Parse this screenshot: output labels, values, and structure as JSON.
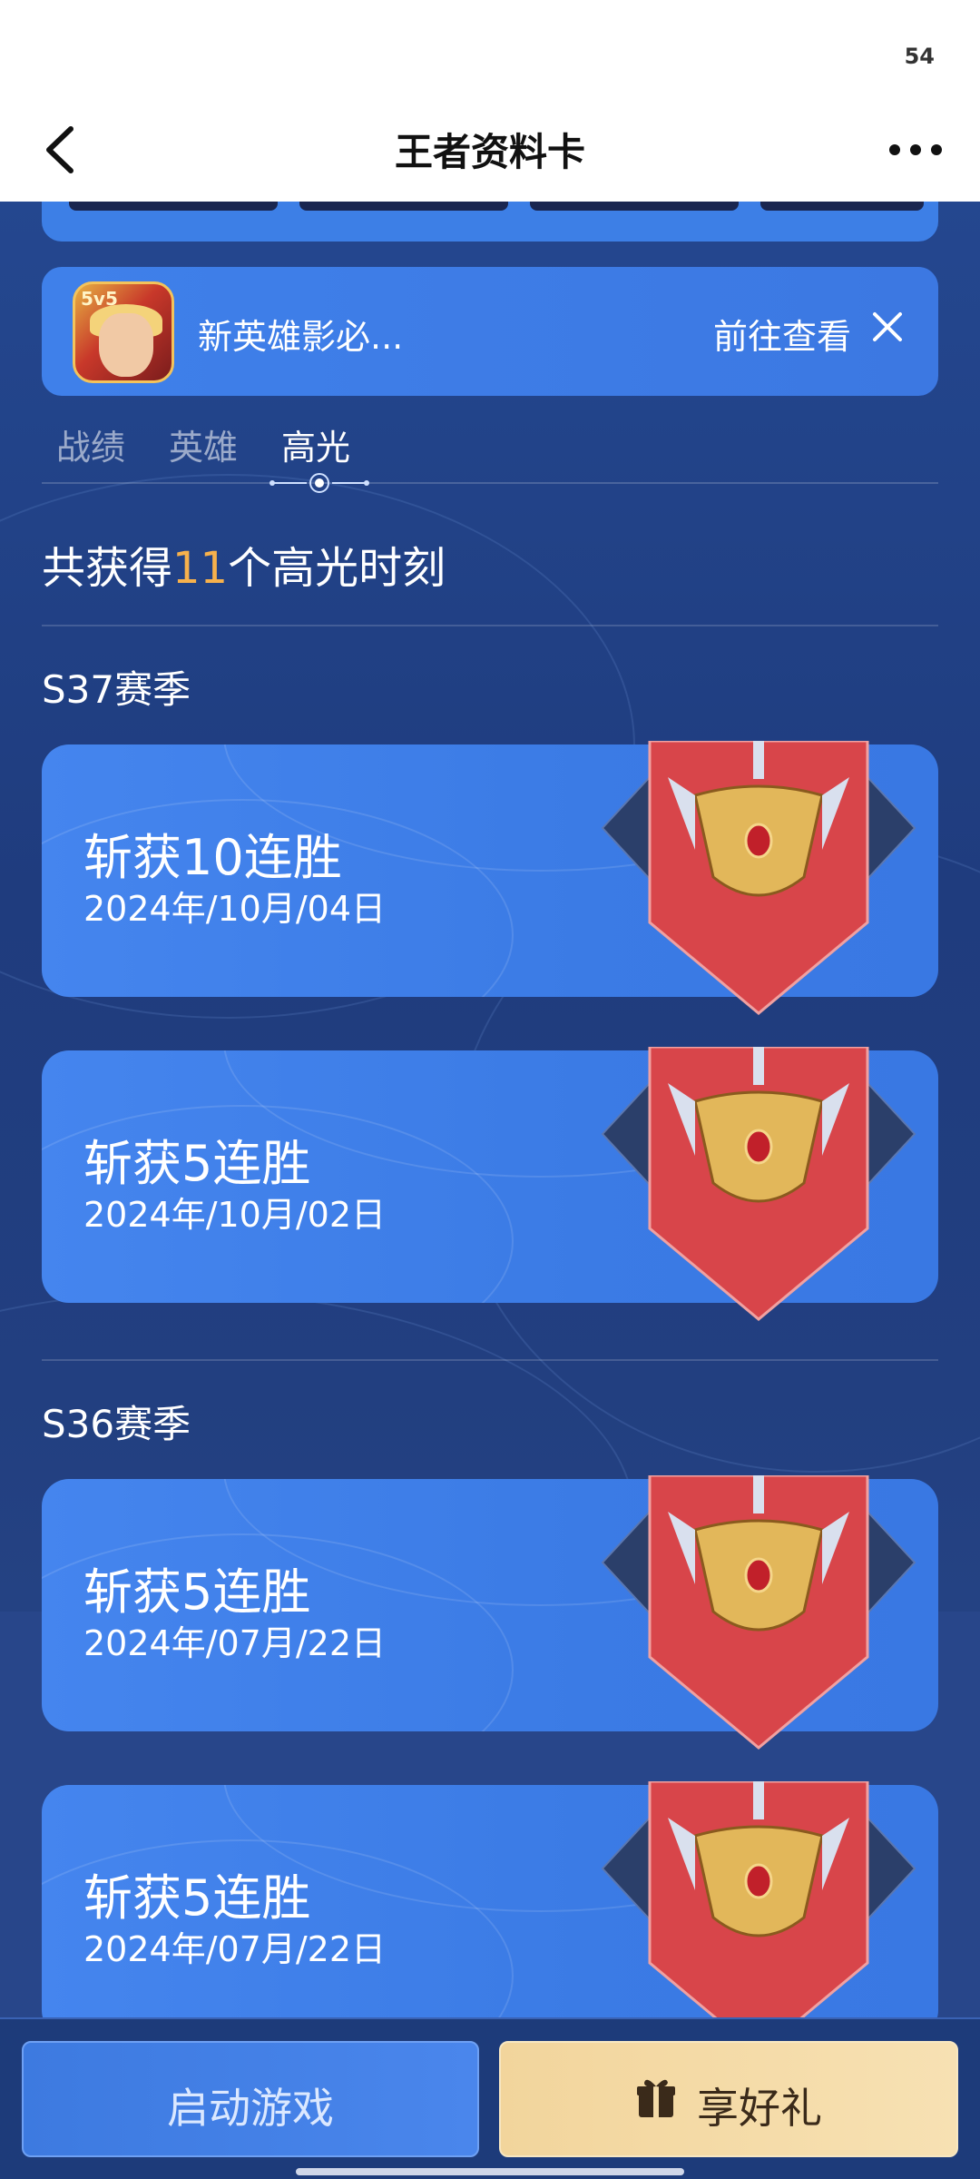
{
  "status_bar": {
    "indicator": "54"
  },
  "header": {
    "title": "王者资料卡",
    "back_icon": "chevron-left-icon",
    "more_icon": "more-icon"
  },
  "banner": {
    "icon_label": "5v5",
    "text": "新英雄影必...",
    "link": "前往查看",
    "close_icon": "close-icon"
  },
  "tabs": [
    {
      "label": "战绩",
      "active": false
    },
    {
      "label": "英雄",
      "active": false
    },
    {
      "label": "高光",
      "active": true
    }
  ],
  "summary": {
    "prefix": "共获得",
    "count": "11",
    "suffix": "个高光时刻"
  },
  "seasons": [
    {
      "label": "S37赛季",
      "items": [
        {
          "title": "斩获10连胜",
          "date": "2024年/10月/04日"
        },
        {
          "title": "斩获5连胜",
          "date": "2024年/10月/02日"
        }
      ]
    },
    {
      "label": "S36赛季",
      "items": [
        {
          "title": "斩获5连胜",
          "date": "2024年/07月/22日"
        },
        {
          "title": "斩获5连胜",
          "date": "2024年/07月/22日"
        }
      ]
    }
  ],
  "bottom": {
    "start_label": "启动游戏",
    "gift_label": "享好礼",
    "gift_icon": "gift-icon"
  },
  "colors": {
    "accent_orange": "#f7b14c",
    "card_blue": "#3f80ea",
    "bg_navy": "#1f3a78",
    "gift_gold": "#f2d59c",
    "badge_red": "#d8454a"
  }
}
